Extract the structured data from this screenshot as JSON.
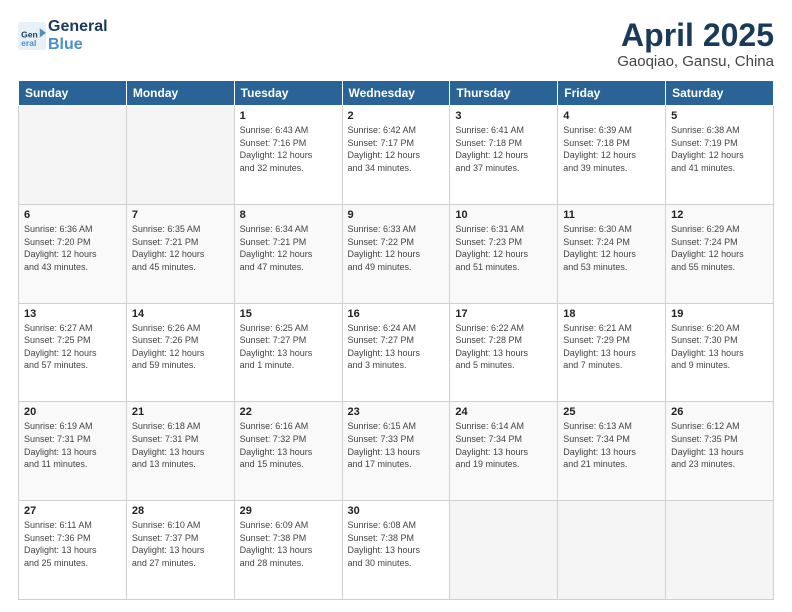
{
  "header": {
    "logo_line1": "General",
    "logo_line2": "Blue",
    "title": "April 2025",
    "subtitle": "Gaoqiao, Gansu, China"
  },
  "days_of_week": [
    "Sunday",
    "Monday",
    "Tuesday",
    "Wednesday",
    "Thursday",
    "Friday",
    "Saturday"
  ],
  "weeks": [
    {
      "days": [
        {
          "num": "",
          "info": "",
          "empty": true
        },
        {
          "num": "",
          "info": "",
          "empty": true
        },
        {
          "num": "1",
          "info": "Sunrise: 6:43 AM\nSunset: 7:16 PM\nDaylight: 12 hours\nand 32 minutes.",
          "empty": false
        },
        {
          "num": "2",
          "info": "Sunrise: 6:42 AM\nSunset: 7:17 PM\nDaylight: 12 hours\nand 34 minutes.",
          "empty": false
        },
        {
          "num": "3",
          "info": "Sunrise: 6:41 AM\nSunset: 7:18 PM\nDaylight: 12 hours\nand 37 minutes.",
          "empty": false
        },
        {
          "num": "4",
          "info": "Sunrise: 6:39 AM\nSunset: 7:18 PM\nDaylight: 12 hours\nand 39 minutes.",
          "empty": false
        },
        {
          "num": "5",
          "info": "Sunrise: 6:38 AM\nSunset: 7:19 PM\nDaylight: 12 hours\nand 41 minutes.",
          "empty": false
        }
      ]
    },
    {
      "days": [
        {
          "num": "6",
          "info": "Sunrise: 6:36 AM\nSunset: 7:20 PM\nDaylight: 12 hours\nand 43 minutes.",
          "empty": false
        },
        {
          "num": "7",
          "info": "Sunrise: 6:35 AM\nSunset: 7:21 PM\nDaylight: 12 hours\nand 45 minutes.",
          "empty": false
        },
        {
          "num": "8",
          "info": "Sunrise: 6:34 AM\nSunset: 7:21 PM\nDaylight: 12 hours\nand 47 minutes.",
          "empty": false
        },
        {
          "num": "9",
          "info": "Sunrise: 6:33 AM\nSunset: 7:22 PM\nDaylight: 12 hours\nand 49 minutes.",
          "empty": false
        },
        {
          "num": "10",
          "info": "Sunrise: 6:31 AM\nSunset: 7:23 PM\nDaylight: 12 hours\nand 51 minutes.",
          "empty": false
        },
        {
          "num": "11",
          "info": "Sunrise: 6:30 AM\nSunset: 7:24 PM\nDaylight: 12 hours\nand 53 minutes.",
          "empty": false
        },
        {
          "num": "12",
          "info": "Sunrise: 6:29 AM\nSunset: 7:24 PM\nDaylight: 12 hours\nand 55 minutes.",
          "empty": false
        }
      ]
    },
    {
      "days": [
        {
          "num": "13",
          "info": "Sunrise: 6:27 AM\nSunset: 7:25 PM\nDaylight: 12 hours\nand 57 minutes.",
          "empty": false
        },
        {
          "num": "14",
          "info": "Sunrise: 6:26 AM\nSunset: 7:26 PM\nDaylight: 12 hours\nand 59 minutes.",
          "empty": false
        },
        {
          "num": "15",
          "info": "Sunrise: 6:25 AM\nSunset: 7:27 PM\nDaylight: 13 hours\nand 1 minute.",
          "empty": false
        },
        {
          "num": "16",
          "info": "Sunrise: 6:24 AM\nSunset: 7:27 PM\nDaylight: 13 hours\nand 3 minutes.",
          "empty": false
        },
        {
          "num": "17",
          "info": "Sunrise: 6:22 AM\nSunset: 7:28 PM\nDaylight: 13 hours\nand 5 minutes.",
          "empty": false
        },
        {
          "num": "18",
          "info": "Sunrise: 6:21 AM\nSunset: 7:29 PM\nDaylight: 13 hours\nand 7 minutes.",
          "empty": false
        },
        {
          "num": "19",
          "info": "Sunrise: 6:20 AM\nSunset: 7:30 PM\nDaylight: 13 hours\nand 9 minutes.",
          "empty": false
        }
      ]
    },
    {
      "days": [
        {
          "num": "20",
          "info": "Sunrise: 6:19 AM\nSunset: 7:31 PM\nDaylight: 13 hours\nand 11 minutes.",
          "empty": false
        },
        {
          "num": "21",
          "info": "Sunrise: 6:18 AM\nSunset: 7:31 PM\nDaylight: 13 hours\nand 13 minutes.",
          "empty": false
        },
        {
          "num": "22",
          "info": "Sunrise: 6:16 AM\nSunset: 7:32 PM\nDaylight: 13 hours\nand 15 minutes.",
          "empty": false
        },
        {
          "num": "23",
          "info": "Sunrise: 6:15 AM\nSunset: 7:33 PM\nDaylight: 13 hours\nand 17 minutes.",
          "empty": false
        },
        {
          "num": "24",
          "info": "Sunrise: 6:14 AM\nSunset: 7:34 PM\nDaylight: 13 hours\nand 19 minutes.",
          "empty": false
        },
        {
          "num": "25",
          "info": "Sunrise: 6:13 AM\nSunset: 7:34 PM\nDaylight: 13 hours\nand 21 minutes.",
          "empty": false
        },
        {
          "num": "26",
          "info": "Sunrise: 6:12 AM\nSunset: 7:35 PM\nDaylight: 13 hours\nand 23 minutes.",
          "empty": false
        }
      ]
    },
    {
      "days": [
        {
          "num": "27",
          "info": "Sunrise: 6:11 AM\nSunset: 7:36 PM\nDaylight: 13 hours\nand 25 minutes.",
          "empty": false
        },
        {
          "num": "28",
          "info": "Sunrise: 6:10 AM\nSunset: 7:37 PM\nDaylight: 13 hours\nand 27 minutes.",
          "empty": false
        },
        {
          "num": "29",
          "info": "Sunrise: 6:09 AM\nSunset: 7:38 PM\nDaylight: 13 hours\nand 28 minutes.",
          "empty": false
        },
        {
          "num": "30",
          "info": "Sunrise: 6:08 AM\nSunset: 7:38 PM\nDaylight: 13 hours\nand 30 minutes.",
          "empty": false
        },
        {
          "num": "",
          "info": "",
          "empty": true
        },
        {
          "num": "",
          "info": "",
          "empty": true
        },
        {
          "num": "",
          "info": "",
          "empty": true
        }
      ]
    }
  ]
}
